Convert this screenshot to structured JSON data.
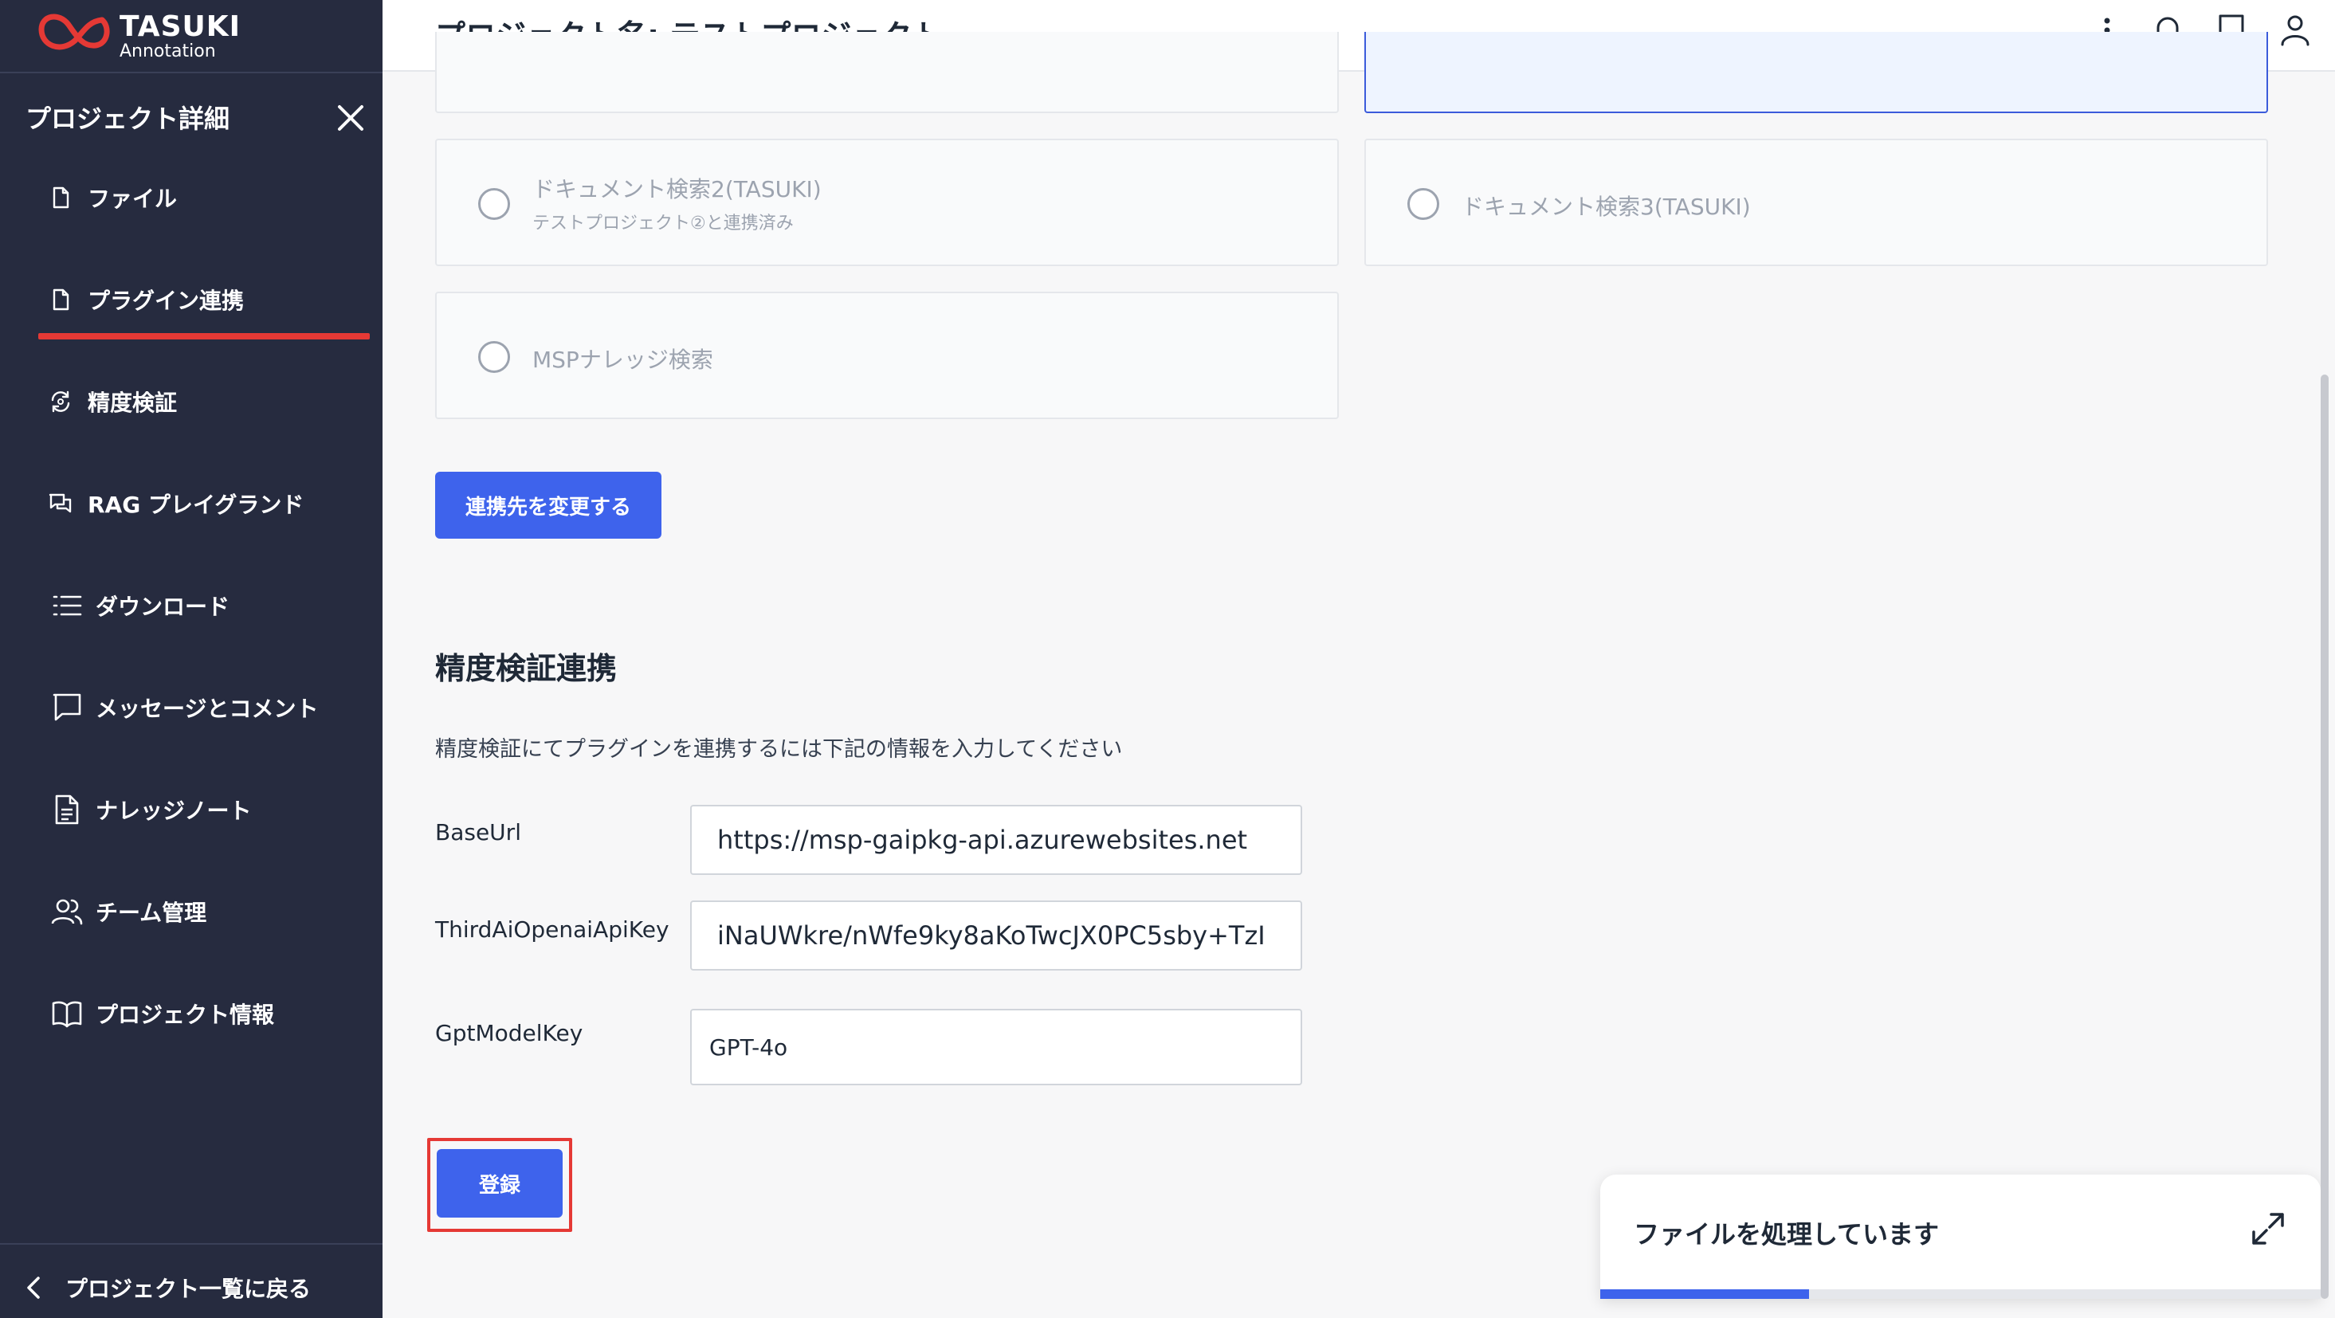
{
  "logo": {
    "brand": "TASUKI",
    "sub": "Annotation"
  },
  "sidebar": {
    "title": "プロジェクト詳細",
    "items": [
      {
        "label": "ファイル",
        "icon": "file-icon"
      },
      {
        "label": "プラグイン連携",
        "icon": "file-icon",
        "active": true
      },
      {
        "label": "精度検証",
        "icon": "refresh-cycle-icon"
      },
      {
        "label": "RAG プレイグランド",
        "icon": "chat-bubbles-icon"
      },
      {
        "label": "ダウンロード",
        "icon": "list-icon"
      },
      {
        "label": "メッセージとコメント",
        "icon": "message-icon"
      },
      {
        "label": "ナレッジノート",
        "icon": "document-icon"
      },
      {
        "label": "チーム管理",
        "icon": "team-icon"
      },
      {
        "label": "プロジェクト情報",
        "icon": "book-open-icon"
      }
    ],
    "back_label": "プロジェクト一覧に戻る"
  },
  "header": {
    "title": "プロジェクト名: テストプロジェクト",
    "icons": [
      "more-vertical-icon",
      "bell-icon",
      "book-icon",
      "user-icon"
    ]
  },
  "plugin_cards": [
    {
      "label": "ドキュメント検索2(TASUKI)",
      "sub": "テストプロジェクト②と連携済み"
    },
    {
      "label": "ドキュメント検索3(TASUKI)"
    },
    {
      "label": "MSPナレッジ検索"
    }
  ],
  "change_button_label": "連携先を変更する",
  "accuracy_section": {
    "title": "精度検証連携",
    "description": "精度検証にてプラグインを連携するには下記の情報を入力してください",
    "fields": [
      {
        "label": "BaseUrl",
        "value": "https://msp-gaipkg-api.azurewebsites.net"
      },
      {
        "label": "ThirdAiOpenaiApiKey",
        "value": "iNaUWkre/nWfe9ky8aKoTwcJX0PC5sby+TzI"
      },
      {
        "label": "GptModelKey",
        "value": "GPT-4o"
      }
    ],
    "submit_label": "登録"
  },
  "toast": {
    "message": "ファイルを処理しています",
    "progress": 0.29
  },
  "colors": {
    "sidebar_bg": "#262b3f",
    "accent": "#3e63ec",
    "active_underline": "#e53935"
  }
}
